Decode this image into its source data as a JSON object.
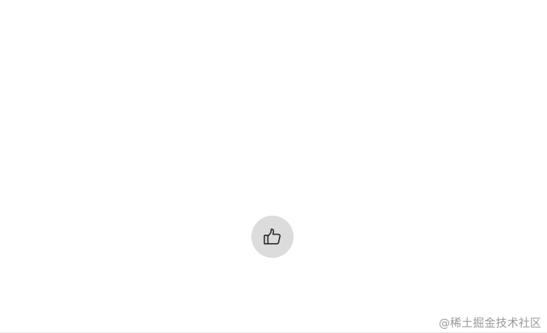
{
  "like_button": {
    "icon": "thumbs-up-icon",
    "background": "#dcdcdc",
    "icon_color": "#2b2b2b"
  },
  "watermark": {
    "text": "@稀土掘金技术社区",
    "color": "#9a9a9a"
  }
}
